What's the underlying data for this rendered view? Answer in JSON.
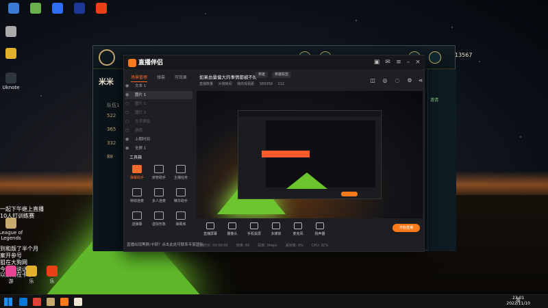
{
  "desktop": {
    "icons": [
      {
        "label": "",
        "color": "#3a7bd5"
      },
      {
        "label": "",
        "color": "#6ab04c"
      },
      {
        "label": "",
        "color": "#2d6ef2"
      },
      {
        "label": "",
        "color": "#1e3799"
      },
      {
        "label": "",
        "color": "#e84118"
      }
    ],
    "left_icons": [
      {
        "label": "",
        "color": "#aaaaaa"
      },
      {
        "label": "",
        "color": "#e1b12c"
      },
      {
        "label": "Uknote",
        "color": "#2f3640"
      },
      {
        "label": "League of Legends",
        "color": "#c8aa6e"
      }
    ],
    "side_texts": [
      "一起下午继上直播",
      "10人打训练赛",
      "到和版了半个月",
      "案开参号",
      "狙在大狗网",
      "今天天说话",
      "以绩现在卡中"
    ],
    "bottom_icons": [
      {
        "label": "游",
        "color": "#e84393"
      },
      {
        "label": "乐",
        "color": "#e1b12c"
      },
      {
        "label": "乐",
        "color": "#e84118"
      }
    ]
  },
  "lol": {
    "title": "米米",
    "team_label": "队伍1",
    "rows": [
      "522",
      "365",
      "332",
      "88"
    ],
    "coins": "13567",
    "right_text": "邀请"
  },
  "app": {
    "brand": "直播伴侣",
    "tabs": [
      "场景管理",
      "弹幕",
      "可效果"
    ],
    "scenes": [
      {
        "name": "文本 1",
        "visible": true
      },
      {
        "name": "图片 1",
        "visible": true
      },
      {
        "name": "图片 1",
        "visible": false
      },
      {
        "name": "图片 2",
        "visible": false
      },
      {
        "name": "文字添加",
        "visible": false
      },
      {
        "name": "游戏",
        "visible": false
      },
      {
        "name": "上期时间",
        "visible": true
      },
      {
        "name": "全屏 1",
        "visible": true
      }
    ],
    "tools_label": "工具箱",
    "tools": [
      {
        "label": "弹幕助手",
        "hot": true
      },
      {
        "label": "房管助手",
        "hot": false
      },
      {
        "label": "主播任务",
        "hot": false
      },
      {
        "label": "特效连麦",
        "hot": false
      },
      {
        "label": "多人连麦",
        "hot": false
      },
      {
        "label": "精华助手",
        "hot": false
      },
      {
        "label": "送弹幕",
        "hot": false
      },
      {
        "label": "虚拟形象",
        "hot": false
      },
      {
        "label": "弹幕库",
        "hot": false
      }
    ],
    "bottom_tip": "直播出现黑屏/卡顿？点击此处可联系专家团队",
    "stream_title": "如果血量偏大的事情都被不好",
    "chip_category": "英雄",
    "chip_game": "英雄联盟",
    "room": [
      "直播数量",
      "大牌房间",
      "我的观看距",
      "589358",
      "112"
    ],
    "controls": [
      {
        "label": "直播屏幕"
      },
      {
        "label": "摄像头"
      },
      {
        "label": "手机投屏"
      },
      {
        "label": "多媒体"
      },
      {
        "label": "麦克风"
      },
      {
        "label": "扬声器"
      }
    ],
    "go_live": "开始直播",
    "status": [
      "近期时长: 00:00:00",
      "帧率: 60",
      "码率: 0kbps",
      "丢帧率: 0%",
      "CPU: 32%"
    ]
  },
  "taskbar": {
    "tray_lang": "英",
    "time": "23:01",
    "date": "2022/11/10",
    "apps": [
      {
        "color": "#0078d7"
      },
      {
        "color": "#db4437"
      },
      {
        "color": "#c8aa6e"
      },
      {
        "color": "#ff7a1a"
      },
      {
        "color": "#f0e6d2"
      }
    ]
  }
}
